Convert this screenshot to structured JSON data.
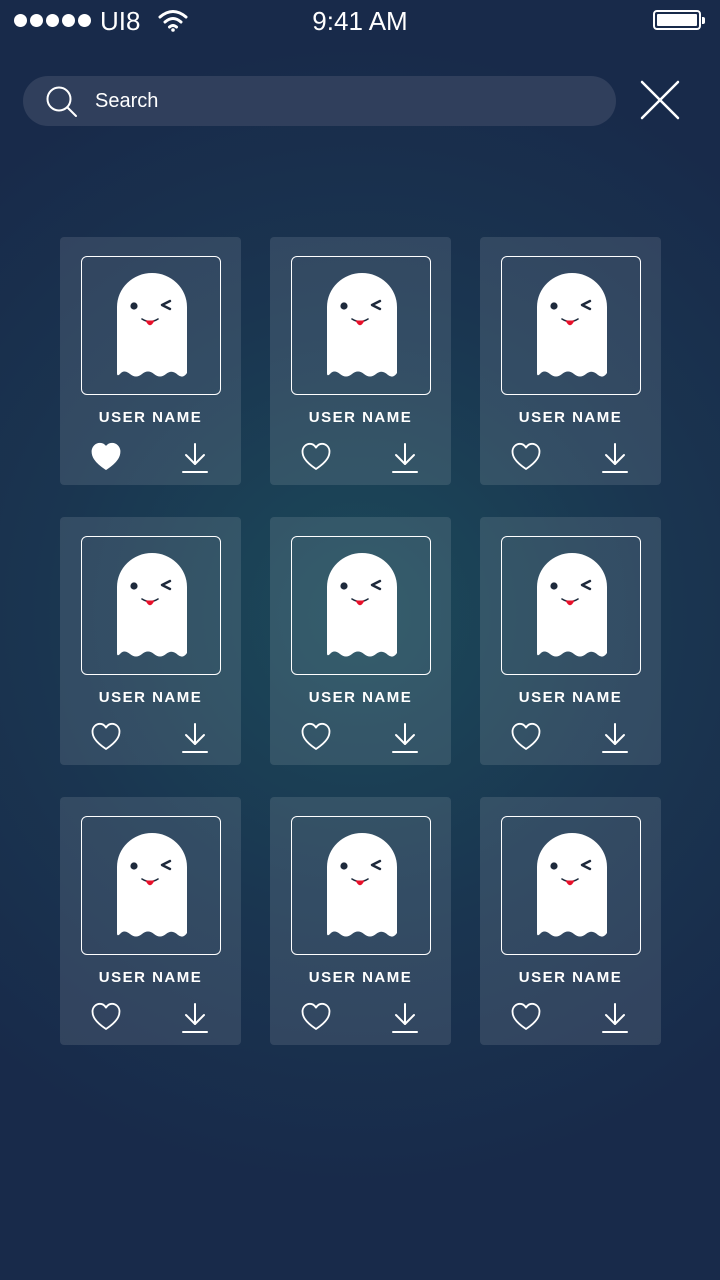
{
  "status_bar": {
    "carrier": "UI8",
    "time": "9:41 AM",
    "signal_dots": 5,
    "icons": [
      "signal-dots-icon",
      "wifi-icon",
      "battery-icon"
    ]
  },
  "search": {
    "placeholder": "Search",
    "icon": "search-icon",
    "close_icon": "close-icon"
  },
  "grid": {
    "items": [
      {
        "name": "USER NAME",
        "liked": true
      },
      {
        "name": "USER NAME",
        "liked": false
      },
      {
        "name": "USER NAME",
        "liked": false
      },
      {
        "name": "USER NAME",
        "liked": false
      },
      {
        "name": "USER NAME",
        "liked": false
      },
      {
        "name": "USER NAME",
        "liked": false
      },
      {
        "name": "USER NAME",
        "liked": false
      },
      {
        "name": "USER NAME",
        "liked": false
      },
      {
        "name": "USER NAME",
        "liked": false
      }
    ],
    "avatar_icon": "ghost-icon",
    "like_icon": "heart-icon",
    "download_icon": "download-icon"
  },
  "colors": {
    "background": "#182a4a",
    "background_glow": "#1c4a5a",
    "search_bg": "#303f5c",
    "ghost_mouth": "#e8102a",
    "text": "#ffffff"
  }
}
